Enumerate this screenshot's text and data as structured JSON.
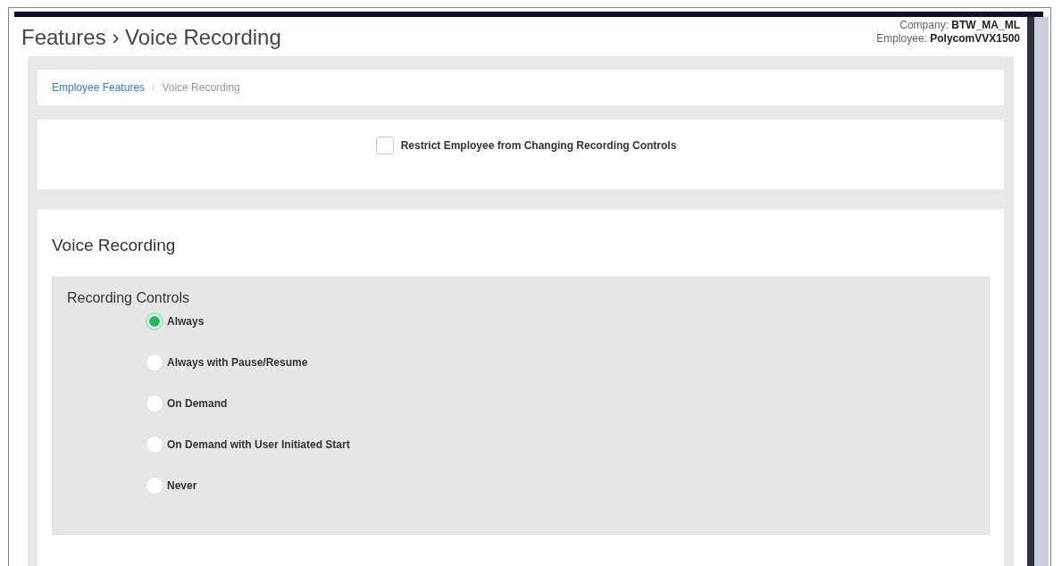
{
  "header": {
    "title": "Features › Voice Recording",
    "company_label": "Company:",
    "company": "BTW_MA_ML",
    "employee_label": "Employee:",
    "employee": "PolycomVVX1500"
  },
  "breadcrumb": [
    {
      "label": "Employee Features",
      "link": true
    },
    {
      "label": "/",
      "link": false
    },
    {
      "label": "Voice Recording",
      "link": false
    }
  ],
  "restrict": {
    "label": "Restrict Employee from Changing Recording Controls",
    "checked": false
  },
  "section": {
    "title": "Voice Recording",
    "group_title": "Recording Controls",
    "options": [
      {
        "label": "Always",
        "selected": true
      },
      {
        "label": "Always with Pause/Resume",
        "selected": false
      },
      {
        "label": "On Demand",
        "selected": false
      },
      {
        "label": "On Demand with User Initiated Start",
        "selected": false
      },
      {
        "label": "Never",
        "selected": false
      }
    ]
  }
}
